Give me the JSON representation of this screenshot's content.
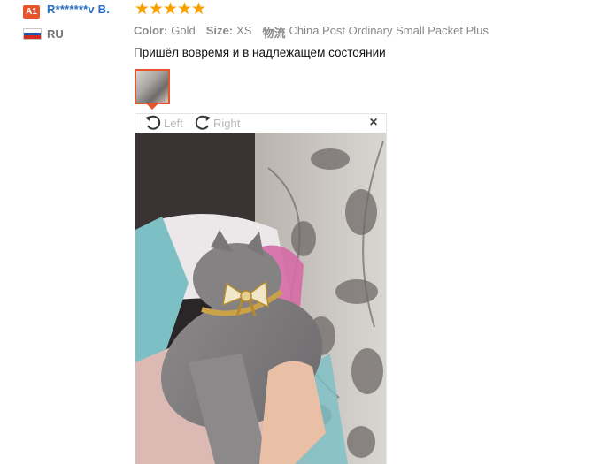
{
  "reviewer": {
    "level": "A1",
    "name": "R*******v B.",
    "country_code": "RU",
    "rating": 5
  },
  "order_info": [
    {
      "label": "Color:",
      "value": "Gold"
    },
    {
      "label": "Size:",
      "value": "XS"
    },
    {
      "label": "物流",
      "value": "China Post Ordinary Small Packet Plus"
    }
  ],
  "feedback_text": "Пришёл вовремя и в надлежащем состоянии",
  "viewer": {
    "rotate_left_label": "Left",
    "rotate_right_label": "Right",
    "close_symbol": "×"
  },
  "colors": {
    "accent": "#e8552c",
    "name_link": "#2a6fc0",
    "star": "#f6a000"
  },
  "icons": [
    "rotate-left-icon",
    "rotate-right-icon",
    "close-icon",
    "star-icon",
    "flag-ru-icon"
  ]
}
